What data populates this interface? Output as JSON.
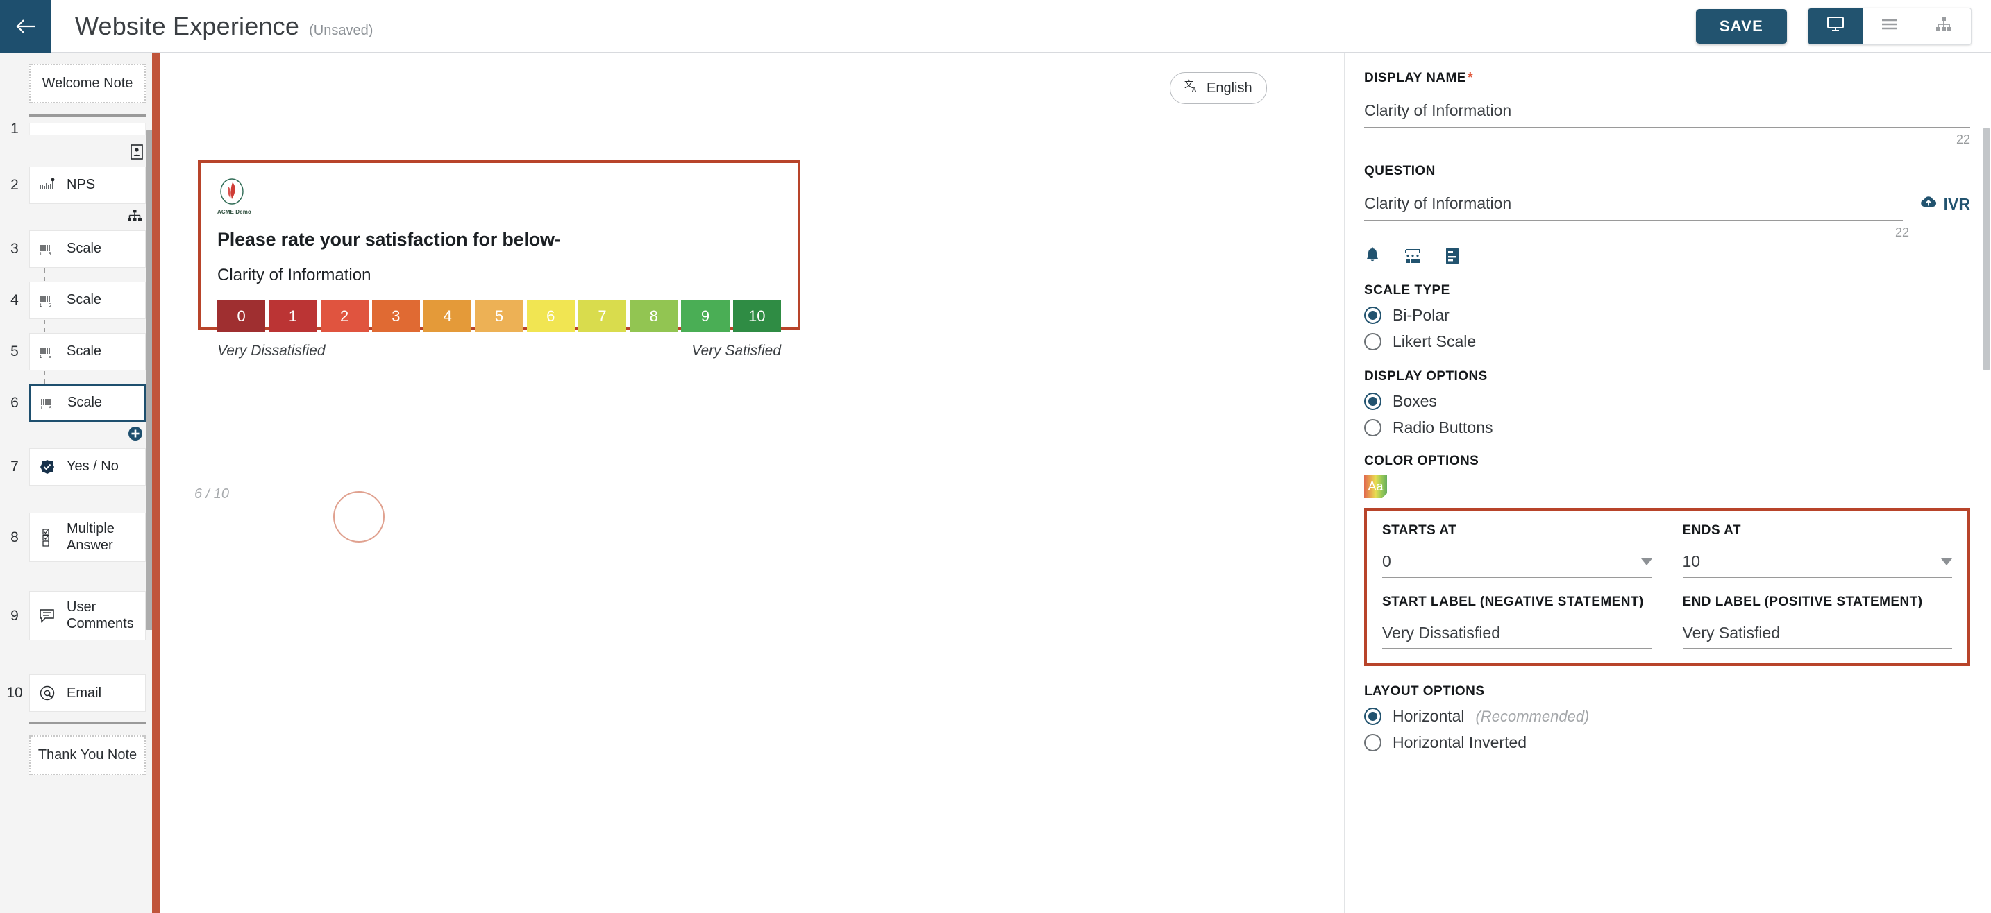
{
  "topbar": {
    "back_icon": "arrow-left-icon",
    "title": "Website Experience",
    "status": "(Unsaved)",
    "save_label": "SAVE",
    "view_desktop_icon": "monitor-icon",
    "view_list_icon": "list-icon",
    "view_tree_icon": "sitemap-icon"
  },
  "sidebar": {
    "welcome_note": "Welcome Note",
    "thank_you_note": "Thank You Note",
    "items": [
      {
        "num": "1",
        "label": "",
        "icon": "contact-card-icon",
        "type": "blank"
      },
      {
        "num": "2",
        "label": "NPS",
        "icon": "nps-icon",
        "type": "card"
      },
      {
        "num": "3",
        "label": "Scale",
        "icon": "scale-icon",
        "type": "card"
      },
      {
        "num": "4",
        "label": "Scale",
        "icon": "scale-icon",
        "type": "card"
      },
      {
        "num": "5",
        "label": "Scale",
        "icon": "scale-icon",
        "type": "card"
      },
      {
        "num": "6",
        "label": "Scale",
        "icon": "scale-icon",
        "type": "card",
        "selected": true
      },
      {
        "num": "7",
        "label": "Yes / No",
        "icon": "check-badge-icon",
        "type": "card"
      },
      {
        "num": "8",
        "label": "Multiple Answer",
        "icon": "checkbox-list-icon",
        "type": "card"
      },
      {
        "num": "9",
        "label": "User Comments",
        "icon": "comment-icon",
        "type": "card"
      },
      {
        "num": "10",
        "label": "Email",
        "icon": "at-icon",
        "type": "card"
      }
    ],
    "add_icon": "add-circle-icon",
    "tool_contact_icon": "contact-card-icon",
    "tool_branch_icon": "sitemap-icon"
  },
  "canvas": {
    "language_label": "English",
    "language_icon": "translate-icon",
    "brand_name": "ACME Demo",
    "question_heading": "Please rate your satisfaction for below-",
    "question_subtext": "Clarity of Information",
    "start_anchor": "Very Dissatisfied",
    "end_anchor": "Very Satisfied",
    "page_counter": "6 / 10"
  },
  "chart_data": {
    "type": "bar",
    "title": "Clarity of Information",
    "categories": [
      "0",
      "1",
      "2",
      "3",
      "4",
      "5",
      "6",
      "7",
      "8",
      "9",
      "10"
    ],
    "values": [
      0,
      1,
      2,
      3,
      4,
      5,
      6,
      7,
      8,
      9,
      10
    ],
    "colors": [
      "#9f2f30",
      "#bb3434",
      "#e0543f",
      "#e06a33",
      "#e49a39",
      "#edb155",
      "#f1e552",
      "#d9dc4d",
      "#92c552",
      "#4aae55",
      "#2f8c44"
    ],
    "xlabel": "Very Dissatisfied",
    "ylabel": "Very Satisfied",
    "legend": [
      "Very Dissatisfied",
      "Very Satisfied"
    ]
  },
  "right_panel": {
    "display_name_label": "DISPLAY NAME",
    "display_name_required": "*",
    "display_name_value": "Clarity of Information",
    "display_name_counter": "22",
    "question_label": "QUESTION",
    "question_value": "Clarity of Information",
    "question_counter": "22",
    "ivr_label": "IVR",
    "ivr_icon": "cloud-upload-icon",
    "tool_icons": [
      "bell-icon",
      "keypad-icon",
      "form-icon"
    ],
    "scale_type_label": "SCALE TYPE",
    "scale_type_options": [
      {
        "label": "Bi-Polar",
        "selected": true
      },
      {
        "label": "Likert Scale",
        "selected": false
      }
    ],
    "display_options_label": "DISPLAY OPTIONS",
    "display_options": [
      {
        "label": "Boxes",
        "selected": true
      },
      {
        "label": "Radio Buttons",
        "selected": false
      }
    ],
    "color_options_label": "COLOR OPTIONS",
    "color_swatch_text": "Aa",
    "starts_at_label": "STARTS AT",
    "starts_at_value": "0",
    "ends_at_label": "ENDS AT",
    "ends_at_value": "10",
    "start_label_label": "START LABEL (NEGATIVE STATEMENT)",
    "start_label_value": "Very Dissatisfied",
    "end_label_label": "END LABEL (POSITIVE STATEMENT)",
    "end_label_value": "Very Satisfied",
    "layout_options_label": "LAYOUT OPTIONS",
    "layout_options": [
      {
        "label": "Horizontal",
        "note": "(Recommended)",
        "selected": true
      },
      {
        "label": "Horizontal Inverted",
        "note": "",
        "selected": false
      }
    ]
  },
  "colors": {
    "brand_navy": "#22536f",
    "accent_red": "#b8442a",
    "sidebar_edge": "#c0553b"
  }
}
